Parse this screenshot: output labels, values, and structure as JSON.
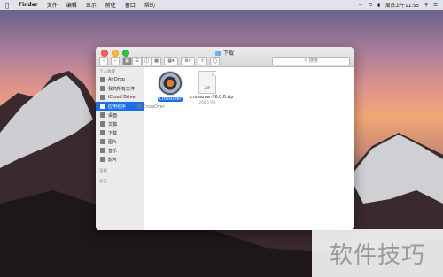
{
  "menubar": {
    "app": "Finder",
    "items": [
      "文件",
      "编辑",
      "显示",
      "前往",
      "窗口",
      "帮助"
    ],
    "clock": "周日上午11:55"
  },
  "window": {
    "title": "下载",
    "search_placeholder": "搜索"
  },
  "sidebar": {
    "favorites_header": "个人收藏",
    "items": [
      {
        "label": "AirDrop",
        "icon": "airdrop-icon"
      },
      {
        "label": "我的所有文件",
        "icon": "all-files-icon"
      },
      {
        "label": "iCloud Drive",
        "icon": "cloud-icon"
      },
      {
        "label": "应用程序",
        "icon": "applications-icon",
        "selected": true
      },
      {
        "label": "桌面",
        "icon": "desktop-icon"
      },
      {
        "label": "文稿",
        "icon": "documents-icon"
      },
      {
        "label": "下载",
        "icon": "downloads-icon"
      },
      {
        "label": "图片",
        "icon": "pictures-icon"
      },
      {
        "label": "音乐",
        "icon": "music-icon"
      },
      {
        "label": "影片",
        "icon": "movies-icon"
      }
    ],
    "devices_header": "设备",
    "tags_header": "标记"
  },
  "files": [
    {
      "name": "CrossOver",
      "kind": "app"
    },
    {
      "name": "crossover-16.0.0.zip",
      "size": "208.5 MB",
      "kind": "zip",
      "tag": "ZIP"
    }
  ],
  "drag_label": "CrossOver",
  "watermark": "软件技巧",
  "colors": {
    "selection": "#1b6ee8",
    "sidebar_bg": "#ebebec"
  }
}
